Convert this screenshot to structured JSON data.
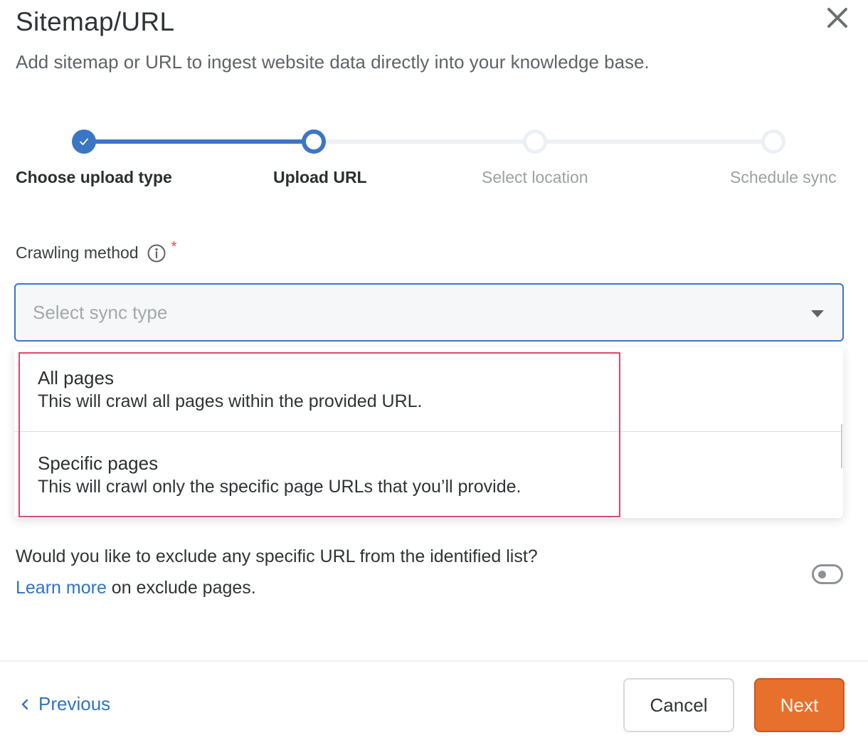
{
  "dialog": {
    "title": "Sitemap/URL",
    "subtitle": "Add sitemap or URL to ingest website data directly into your knowledge base."
  },
  "stepper": {
    "steps": [
      {
        "label": "Choose upload type",
        "state": "complete"
      },
      {
        "label": "Upload URL",
        "state": "active"
      },
      {
        "label": "Select location",
        "state": "pending"
      },
      {
        "label": "Schedule sync",
        "state": "pending"
      }
    ]
  },
  "crawling": {
    "label": "Crawling method",
    "required_mark": "*",
    "placeholder": "Select sync type",
    "options": [
      {
        "title": "All pages",
        "description": "This will crawl all pages within the provided URL."
      },
      {
        "title": "Specific pages",
        "description": "This will crawl only the specific page URLs that you’ll provide."
      }
    ]
  },
  "exclude": {
    "question": "Would you like to exclude any specific URL from the identified list?",
    "link_text": "Learn more",
    "suffix": " on exclude pages.",
    "toggle_on": false
  },
  "footer": {
    "previous_label": "Previous",
    "cancel_label": "Cancel",
    "next_label": "Next"
  },
  "colors": {
    "accent": "#3b76c6",
    "primary_button": "#e8702d",
    "highlight_border": "#d94a6c",
    "required": "#e0454b"
  },
  "icons": {
    "close": "close-icon",
    "check": "check-icon",
    "info": "info-icon",
    "caret": "caret-down-icon",
    "previous": "chevron-left-icon"
  }
}
